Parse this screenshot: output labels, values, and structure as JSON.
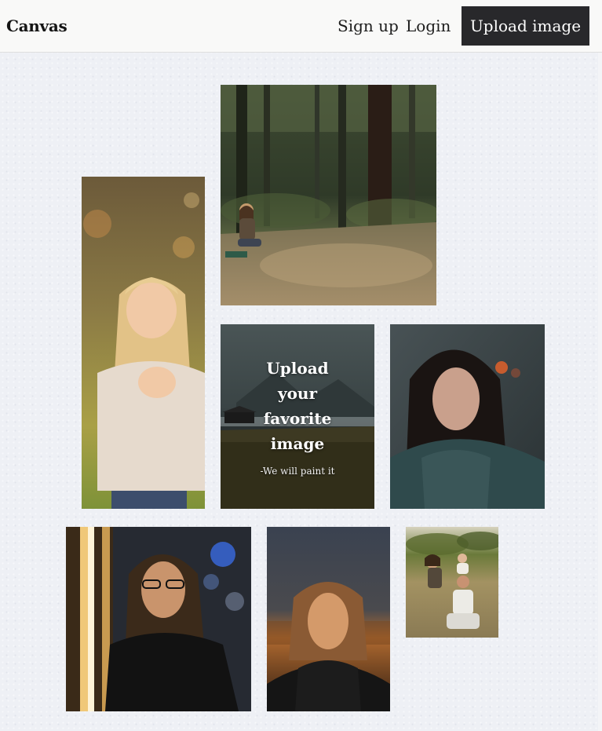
{
  "navbar": {
    "brand": "Canvas",
    "signup_label": "Sign up",
    "login_label": "Login",
    "upload_label": "Upload image"
  },
  "cta": {
    "title": "Upload\nyour\nfavorite\nimage",
    "subtitle": "-We will paint it"
  },
  "gallery": [
    {
      "name": "photo-child-in-forest",
      "subject": "child sitting on forest path"
    },
    {
      "name": "photo-smiling-girl",
      "subject": "smiling blonde girl in sweater"
    },
    {
      "name": "photo-woman-rain-jacket",
      "subject": "woman in rain jacket"
    },
    {
      "name": "photo-man-glasses",
      "subject": "man with glasses and long hair"
    },
    {
      "name": "photo-woman-sunset",
      "subject": "woman at sunset"
    },
    {
      "name": "photo-family-field",
      "subject": "family in a field"
    }
  ],
  "colors": {
    "navbar_bg": "#f9f9f8",
    "button_bg": "#28282b",
    "page_bg": "#eef0f5"
  }
}
